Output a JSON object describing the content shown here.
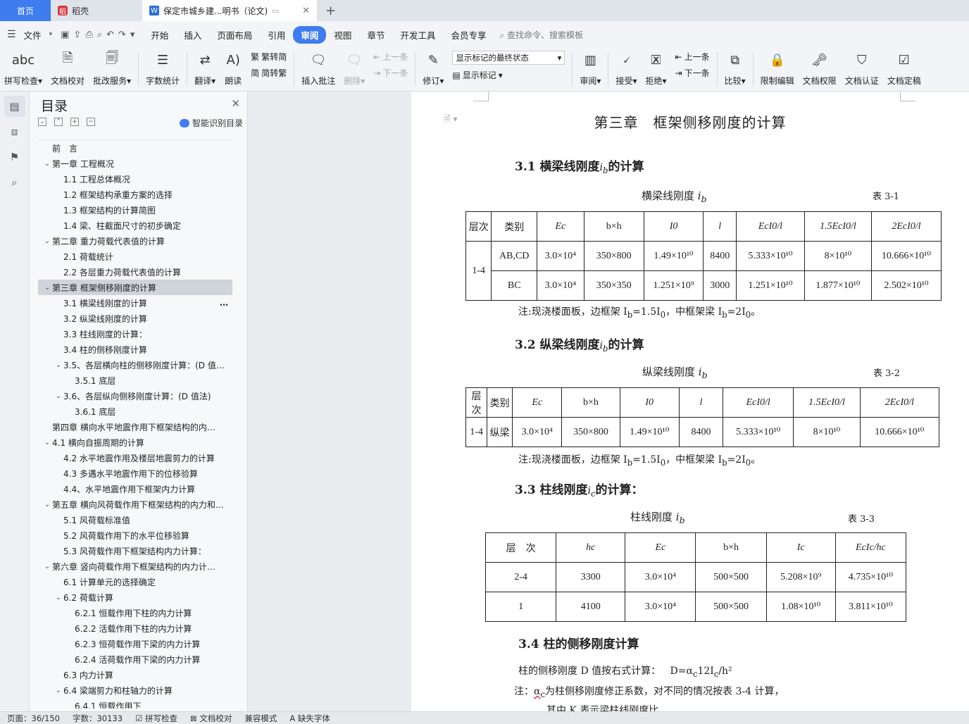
{
  "tabs": {
    "home": "首页",
    "daoke": "稻壳",
    "doc": "保定市城乡建...明书（论文)",
    "plus": "+"
  },
  "menu": {
    "file": "文件",
    "items": [
      "开始",
      "插入",
      "页面布局",
      "引用",
      "审阅",
      "视图",
      "章节",
      "开发工具",
      "会员专享"
    ],
    "search": "查找命令、搜索模板"
  },
  "ribbon": {
    "spell": "拼写检查",
    "proof": "文档校对",
    "revise_service": "批改服务",
    "word_count": "字数统计",
    "translate": "翻译",
    "read": "朗读",
    "trad2simp": "繁转简",
    "simp2trad": "简转繁",
    "insert_comment": "插入批注",
    "delete": "删除",
    "prev": "上一条",
    "next": "下一条",
    "track": "修订",
    "markup_combo": "显示标记的最终状态",
    "show_markup": "显示标记",
    "review": "审阅",
    "accept": "接受",
    "reject": "拒绝",
    "prev2": "上一条",
    "next2": "下一条",
    "compare": "比较",
    "restrict": "限制编辑",
    "rights": "文档权限",
    "certify": "文档认证",
    "finalize": "文档定稿"
  },
  "nav": {
    "title": "目录",
    "smart": "智能识别目录",
    "items": [
      {
        "text": "前　言",
        "level": 1,
        "arrow": ""
      },
      {
        "text": "第一章  工程概况",
        "level": 1,
        "arrow": "v"
      },
      {
        "text": "1.1 工程总体概况",
        "level": 2,
        "arrow": ""
      },
      {
        "text": "1.2 框架结构承重方案的选择",
        "level": 2,
        "arrow": ""
      },
      {
        "text": "1.3  框架结构的计算简图",
        "level": 2,
        "arrow": ""
      },
      {
        "text": "1.4  梁、柱截面尺寸的初步确定",
        "level": 2,
        "arrow": ""
      },
      {
        "text": "第二章  重力荷载代表值的计算",
        "level": 1,
        "arrow": "v"
      },
      {
        "text": "2.1 荷载统计",
        "level": 2,
        "arrow": ""
      },
      {
        "text": "2.2 各层重力荷载代表值的计算",
        "level": 2,
        "arrow": ""
      },
      {
        "text": "第三章    框架侧移刚度的计算",
        "level": 1,
        "arrow": "v",
        "sel": true
      },
      {
        "text": "3.1 横梁线刚度的计算",
        "level": 2,
        "arrow": "",
        "more": true
      },
      {
        "text": "3.2 纵梁线刚度的计算",
        "level": 2,
        "arrow": ""
      },
      {
        "text": "3.3 柱线刚度的计算：",
        "level": 2,
        "arrow": ""
      },
      {
        "text": "3.4 柱的侧移刚度计算",
        "level": 2,
        "arrow": ""
      },
      {
        "text": "3.5、各层横向柱的侧移刚度计算：(D 值…",
        "level": 2,
        "arrow": "v"
      },
      {
        "text": "3.5.1 底层",
        "level": 3,
        "arrow": ""
      },
      {
        "text": "3.6、各层纵向侧移刚度计算：(D 值法)",
        "level": 2,
        "arrow": "v"
      },
      {
        "text": "3.6.1 底层",
        "level": 3,
        "arrow": ""
      },
      {
        "text": "第四章    横向水平地震作用下框架结构的内…",
        "level": 1,
        "arrow": ""
      },
      {
        "text": "4.1 横向自振周期的计算",
        "level": 1,
        "arrow": "v"
      },
      {
        "text": "4.2 水平地震作用及楼层地震剪力的计算",
        "level": 2,
        "arrow": ""
      },
      {
        "text": "4.3 多遇水平地震作用下的位移验算",
        "level": 2,
        "arrow": ""
      },
      {
        "text": "4.4、水平地震作用下框架内力计算",
        "level": 2,
        "arrow": ""
      },
      {
        "text": "第五章  横向风荷载作用下框架结构的内力和…",
        "level": 1,
        "arrow": "v"
      },
      {
        "text": "5.1 风荷载标准值",
        "level": 2,
        "arrow": ""
      },
      {
        "text": "5.2 风荷载作用下的水平位移验算",
        "level": 2,
        "arrow": ""
      },
      {
        "text": "5.3 风荷载作用下框架结构内力计算：",
        "level": 2,
        "arrow": ""
      },
      {
        "text": "第六章    竖向荷载作用下框架结构的内力计…",
        "level": 1,
        "arrow": "v"
      },
      {
        "text": "6.1 计算单元的选择确定",
        "level": 2,
        "arrow": ""
      },
      {
        "text": "6.2 荷载计算",
        "level": 2,
        "arrow": "v"
      },
      {
        "text": "6.2.1 恒载作用下柱的内力计算",
        "level": 3,
        "arrow": ""
      },
      {
        "text": "6.2.2 活载作用下柱的内力计算",
        "level": 3,
        "arrow": ""
      },
      {
        "text": "6.2.3 恒荷载作用下梁的内力计算",
        "level": 3,
        "arrow": ""
      },
      {
        "text": "6.2.4 活荷载作用下梁的内力计算",
        "level": 3,
        "arrow": ""
      },
      {
        "text": "6.3 内力计算",
        "level": 2,
        "arrow": ""
      },
      {
        "text": "6.4 梁端剪力和柱轴力的计算",
        "level": 2,
        "arrow": "v"
      },
      {
        "text": "6.4.1 恒载作用下",
        "level": 3,
        "arrow": ""
      }
    ]
  },
  "doc": {
    "chapter": "第三章　框架侧移刚度的计算",
    "s31": "3.1 横梁线刚度",
    "s31b": "的计算",
    "cap1": "横梁线刚度",
    "tab1": "表 3-1",
    "s32": "3.2 纵梁线刚度",
    "s32b": "的计算",
    "cap2": "纵梁线刚度",
    "tab2": "表 3-2",
    "s33": "3.3 柱线刚度",
    "s33b": "的计算：",
    "cap3": "柱线刚度",
    "tab3": "表 3-3",
    "s34": "3.4 柱的侧移刚度计算",
    "note1": "注:现浇楼面板，边框架 I",
    "note1b": "=1.5I",
    "note1c": "，中框架梁 I",
    "note1d": "=2I",
    "note1e": "。",
    "p1": "柱的侧移刚度 D 值按右式计算：",
    "p1f": "D=α",
    "p1g": "12I",
    "p1h": "/h²",
    "p2a": "注：",
    "p2b": "α",
    "p2c": "为柱侧移刚度修正系数，对不同的情况按表 3-4 计算，",
    "p3": "其中 K 表示梁柱线刚度比"
  },
  "table1": {
    "head": [
      "层次",
      "类别",
      "Ec",
      "b×h",
      "I0",
      "l",
      "EcI0/l",
      "1.5EcI0/l",
      "2EcI0/l"
    ],
    "floor": "1-4",
    "rows": [
      [
        "AB,CD",
        "3.0×10⁴",
        "350×800",
        "1.49×10¹⁰",
        "8400",
        "5.333×10¹⁰",
        "8×10¹⁰",
        "10.666×10¹⁰"
      ],
      [
        "BC",
        "3.0×10⁴",
        "350×350",
        "1.251×10⁹",
        "3000",
        "1.251×10¹⁰",
        "1.877×10¹⁰",
        "2.502×10¹⁰"
      ]
    ]
  },
  "table2": {
    "head": [
      "层次",
      "类别",
      "Ec",
      "b×h",
      "I0",
      "l",
      "EcI0/l",
      "1.5EcI0/l",
      "2EcI0/l"
    ],
    "row": [
      "1-4",
      "纵梁",
      "3.0×10⁴",
      "350×800",
      "1.49×10¹⁰",
      "8400",
      "5.333×10¹⁰",
      "8×10¹⁰",
      "10.666×10¹⁰"
    ]
  },
  "table3": {
    "head": [
      "层　次",
      "hc",
      "Ec",
      "b×h",
      "Ic",
      "EcIc/hc"
    ],
    "rows": [
      [
        "2-4",
        "3300",
        "3.0×10⁴",
        "500×500",
        "5.208×10⁹",
        "4.735×10¹⁰"
      ],
      [
        "1",
        "4100",
        "3.0×10⁴",
        "500×500",
        "1.08×10¹⁰",
        "3.811×10¹⁰"
      ]
    ]
  },
  "status": {
    "page": "页面：36/150",
    "words": "字数：30133",
    "spell": "拼写检查",
    "proof": "文档校对",
    "compat": "兼容模式",
    "font": "缺失字体"
  }
}
